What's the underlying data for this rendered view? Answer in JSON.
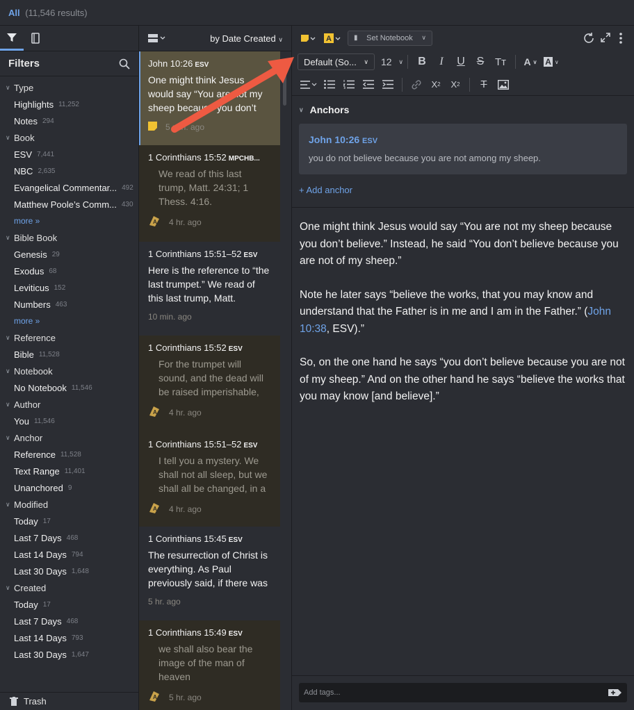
{
  "header": {
    "all_label": "All",
    "result_count": "(11,546 results)"
  },
  "sidebar": {
    "title": "Filters",
    "trash_label": "Trash",
    "rows": [
      {
        "kind": "group",
        "label": "Type"
      },
      {
        "kind": "item",
        "label": "Highlights",
        "count": "11,252"
      },
      {
        "kind": "item",
        "label": "Notes",
        "count": "294"
      },
      {
        "kind": "group",
        "label": "Book"
      },
      {
        "kind": "item",
        "label": "ESV",
        "count": "7,441"
      },
      {
        "kind": "item",
        "label": "NBC",
        "count": "2,635"
      },
      {
        "kind": "item",
        "label": "Evangelical Commentar...",
        "count": "492"
      },
      {
        "kind": "item",
        "label": "Matthew Poole’s Comm...",
        "count": "430"
      },
      {
        "kind": "more",
        "label": "more »"
      },
      {
        "kind": "group",
        "label": "Bible Book"
      },
      {
        "kind": "item",
        "label": "Genesis",
        "count": "29"
      },
      {
        "kind": "item",
        "label": "Exodus",
        "count": "68"
      },
      {
        "kind": "item",
        "label": "Leviticus",
        "count": "152"
      },
      {
        "kind": "item",
        "label": "Numbers",
        "count": "463"
      },
      {
        "kind": "more",
        "label": "more »"
      },
      {
        "kind": "group",
        "label": "Reference"
      },
      {
        "kind": "item",
        "label": "Bible",
        "count": "11,528"
      },
      {
        "kind": "group",
        "label": "Notebook"
      },
      {
        "kind": "item",
        "label": "No Notebook",
        "count": "11,546"
      },
      {
        "kind": "group",
        "label": "Author"
      },
      {
        "kind": "item",
        "label": "You",
        "count": "11,546"
      },
      {
        "kind": "group",
        "label": "Anchor"
      },
      {
        "kind": "item",
        "label": "Reference",
        "count": "11,528"
      },
      {
        "kind": "item",
        "label": "Text Range",
        "count": "11,401"
      },
      {
        "kind": "item",
        "label": "Unanchored",
        "count": "9"
      },
      {
        "kind": "group",
        "label": "Modified"
      },
      {
        "kind": "item",
        "label": "Today",
        "count": "17"
      },
      {
        "kind": "item",
        "label": "Last 7 Days",
        "count": "468"
      },
      {
        "kind": "item",
        "label": "Last 14 Days",
        "count": "794"
      },
      {
        "kind": "item",
        "label": "Last 30 Days",
        "count": "1,648"
      },
      {
        "kind": "group",
        "label": "Created"
      },
      {
        "kind": "item",
        "label": "Today",
        "count": "17"
      },
      {
        "kind": "item",
        "label": "Last 7 Days",
        "count": "468"
      },
      {
        "kind": "item",
        "label": "Last 14 Days",
        "count": "793"
      },
      {
        "kind": "item",
        "label": "Last 30 Days",
        "count": "1,647"
      }
    ]
  },
  "list": {
    "sort_label": "by Date Created",
    "notes": [
      {
        "ref": "John 10:26",
        "version": "ESV",
        "kind": "note",
        "text": "One might think Jesus would say “You are not my sheep because you don’t believe.”",
        "time": "5 min. ago",
        "icon": "note-icon",
        "selected": true
      },
      {
        "ref": "1 Corinthians 15:52",
        "version": "MPCHB...",
        "kind": "highlight",
        "text": "We read of this last trump, Matt. 24:31; 1 Thess. 4:16.",
        "time": "4 hr. ago",
        "icon": "highlight-icon"
      },
      {
        "ref": "1 Corinthians 15:51–52",
        "version": "ESV",
        "kind": "note",
        "text": "Here is the reference to “the last trumpet.” We read of this last trump, Matt.",
        "time": "10 min. ago",
        "icon": ""
      },
      {
        "ref": "1 Corinthians 15:52",
        "version": "ESV",
        "kind": "highlight",
        "text": "For the trumpet will sound, and the dead will be raised imperishable, and",
        "time": "4 hr. ago",
        "icon": "highlight-icon"
      },
      {
        "ref": "1 Corinthians 15:51–52",
        "version": "ESV",
        "kind": "highlight",
        "text": "I tell you a mystery. We shall not all sleep, but we shall all be changed, in a",
        "time": "4 hr. ago",
        "icon": "highlight-icon"
      },
      {
        "ref": "1 Corinthians 15:45",
        "version": "ESV",
        "kind": "note",
        "text": "The resurrection of Christ is everything. As Paul previously said, if there was",
        "time": "5 hr. ago",
        "icon": ""
      },
      {
        "ref": "1 Corinthians 15:49",
        "version": "ESV",
        "kind": "highlight",
        "text": "we shall also bear the image of the man of heaven",
        "time": "5 hr. ago",
        "icon": "highlight-icon"
      }
    ]
  },
  "editor": {
    "notebook_label": "Set Notebook",
    "font_label": "Default (So...",
    "size_label": "12",
    "anchors_title": "Anchors",
    "anchor_ref": "John 10:26",
    "anchor_version": "ESV",
    "anchor_text": "you do not believe because you are not among my sheep.",
    "add_anchor": "+ Add anchor",
    "para1": "One might think Jesus would say “You are not my sheep because you don’t believe.” Instead, he said “You don’t believe because you are not of my sheep.”",
    "para2_a": "Note he later says “believe the works, that you may know and understand that the Father is in me and I am in the Father.” (",
    "para2_link": "John 10:38",
    "para2_b": ", ESV).”",
    "para3": "So, on the one hand he says “you don’t believe because you are not of my sheep.” And on the other hand he says “believe the works that you may know [and believe].”",
    "tags_placeholder": "Add tags..."
  },
  "colors": {
    "accent": "#6fa3e8",
    "note_bg": "#3f3a2c",
    "highlight_bg": "#2f2c24",
    "selected_bg": "#5a5440",
    "arrow": "#ee5a42"
  }
}
